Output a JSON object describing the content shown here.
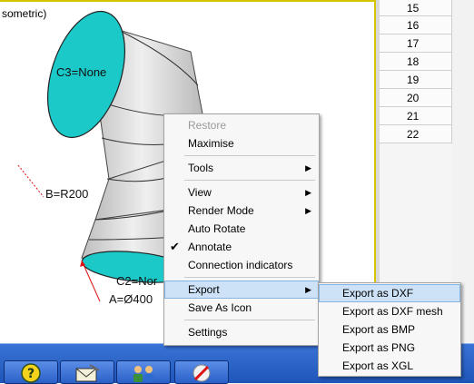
{
  "viewport": {
    "view_title": "sometric)",
    "annotations": {
      "c3": "C3=None",
      "b": "B=R200",
      "c2": "C2=Nor",
      "a": "A=Ø400"
    }
  },
  "grid": {
    "rows": [
      "15",
      "16",
      "17",
      "18",
      "19",
      "20",
      "21",
      "22"
    ]
  },
  "context_menu": {
    "items": [
      {
        "label": "Restore",
        "disabled": true
      },
      {
        "label": "Maximise"
      },
      {
        "separator": true
      },
      {
        "label": "Tools",
        "submenu": true
      },
      {
        "separator": true
      },
      {
        "label": "View",
        "submenu": true
      },
      {
        "label": "Render Mode",
        "submenu": true
      },
      {
        "label": "Auto Rotate"
      },
      {
        "label": "Annotate",
        "checked": true
      },
      {
        "label": "Connection indicators"
      },
      {
        "separator": true
      },
      {
        "label": "Export",
        "submenu": true,
        "highlighted": true
      },
      {
        "label": "Save As Icon"
      },
      {
        "separator": true
      },
      {
        "label": "Settings"
      }
    ]
  },
  "export_submenu": {
    "items": [
      {
        "label": "Export as DXF",
        "highlighted": true
      },
      {
        "label": "Export as DXF mesh"
      },
      {
        "label": "Export as BMP"
      },
      {
        "label": "Export as PNG"
      },
      {
        "label": "Export as XGL"
      }
    ]
  },
  "taskbar": {
    "buttons": [
      "help-icon",
      "mail-icon",
      "users-icon",
      "disconnect-icon"
    ]
  },
  "colors": {
    "end_cap": "#1cc9c9",
    "pipe": "#d9d9d9",
    "highlight": "#cde2f7",
    "taskbar": "#2a5fc7",
    "accent_border": "#d4c400"
  }
}
